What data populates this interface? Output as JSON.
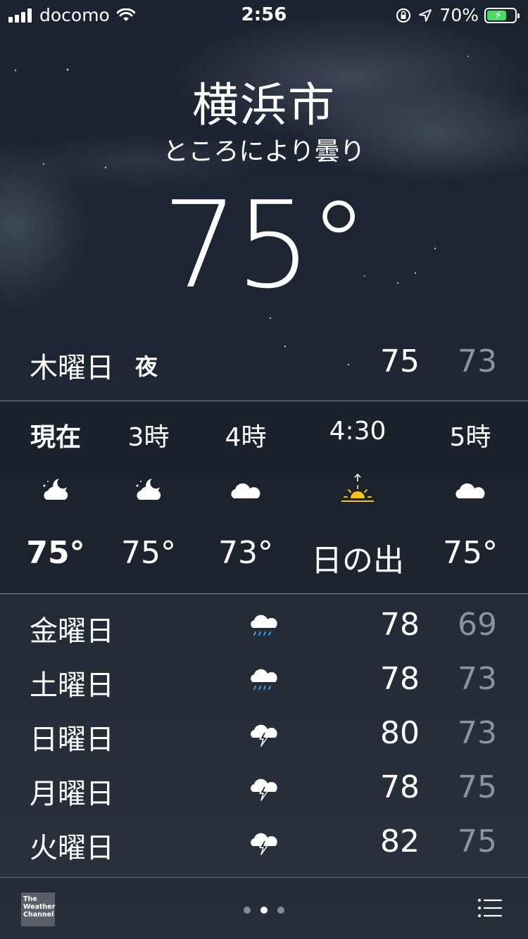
{
  "status_bar": {
    "carrier": "docomo",
    "time": "2:56",
    "battery_percent": "70%",
    "battery_level": 0.7,
    "icons": [
      "signal-icon",
      "wifi-icon",
      "orientation-lock-icon",
      "location-arrow-icon",
      "battery-charging-icon"
    ]
  },
  "header": {
    "city": "横浜市",
    "condition": "ところにより曇り",
    "temperature": "75°"
  },
  "today": {
    "day": "木曜日",
    "period": "夜",
    "high": "75",
    "low": "73"
  },
  "hourly": [
    {
      "label": "現在",
      "icon": "partly-cloudy-night-icon",
      "temp": "75°",
      "bold": true
    },
    {
      "label": "3時",
      "icon": "partly-cloudy-night-icon",
      "temp": "75°",
      "bold": false
    },
    {
      "label": "4時",
      "icon": "cloud-icon",
      "temp": "73°",
      "bold": false
    },
    {
      "label": "4:30",
      "icon": "sunrise-icon",
      "temp": "日の出",
      "bold": false
    },
    {
      "label": "5時",
      "icon": "cloud-icon",
      "temp": "75°",
      "bold": false
    }
  ],
  "daily": [
    {
      "day": "金曜日",
      "icon": "rain-icon",
      "high": "78",
      "low": "69"
    },
    {
      "day": "土曜日",
      "icon": "rain-icon",
      "high": "78",
      "low": "73"
    },
    {
      "day": "日曜日",
      "icon": "thunderstorm-icon",
      "high": "80",
      "low": "73"
    },
    {
      "day": "月曜日",
      "icon": "thunderstorm-icon",
      "high": "78",
      "low": "75"
    },
    {
      "day": "火曜日",
      "icon": "thunderstorm-icon",
      "high": "82",
      "low": "75"
    }
  ],
  "footer": {
    "logo_text": [
      "The",
      "Weather",
      "Channel"
    ],
    "page_count": 3,
    "active_page": 1
  },
  "colors": {
    "low_temp": "#8e939b",
    "sun": "#f5c518",
    "rain": "#3aa0e8",
    "battery": "#4cd964"
  }
}
